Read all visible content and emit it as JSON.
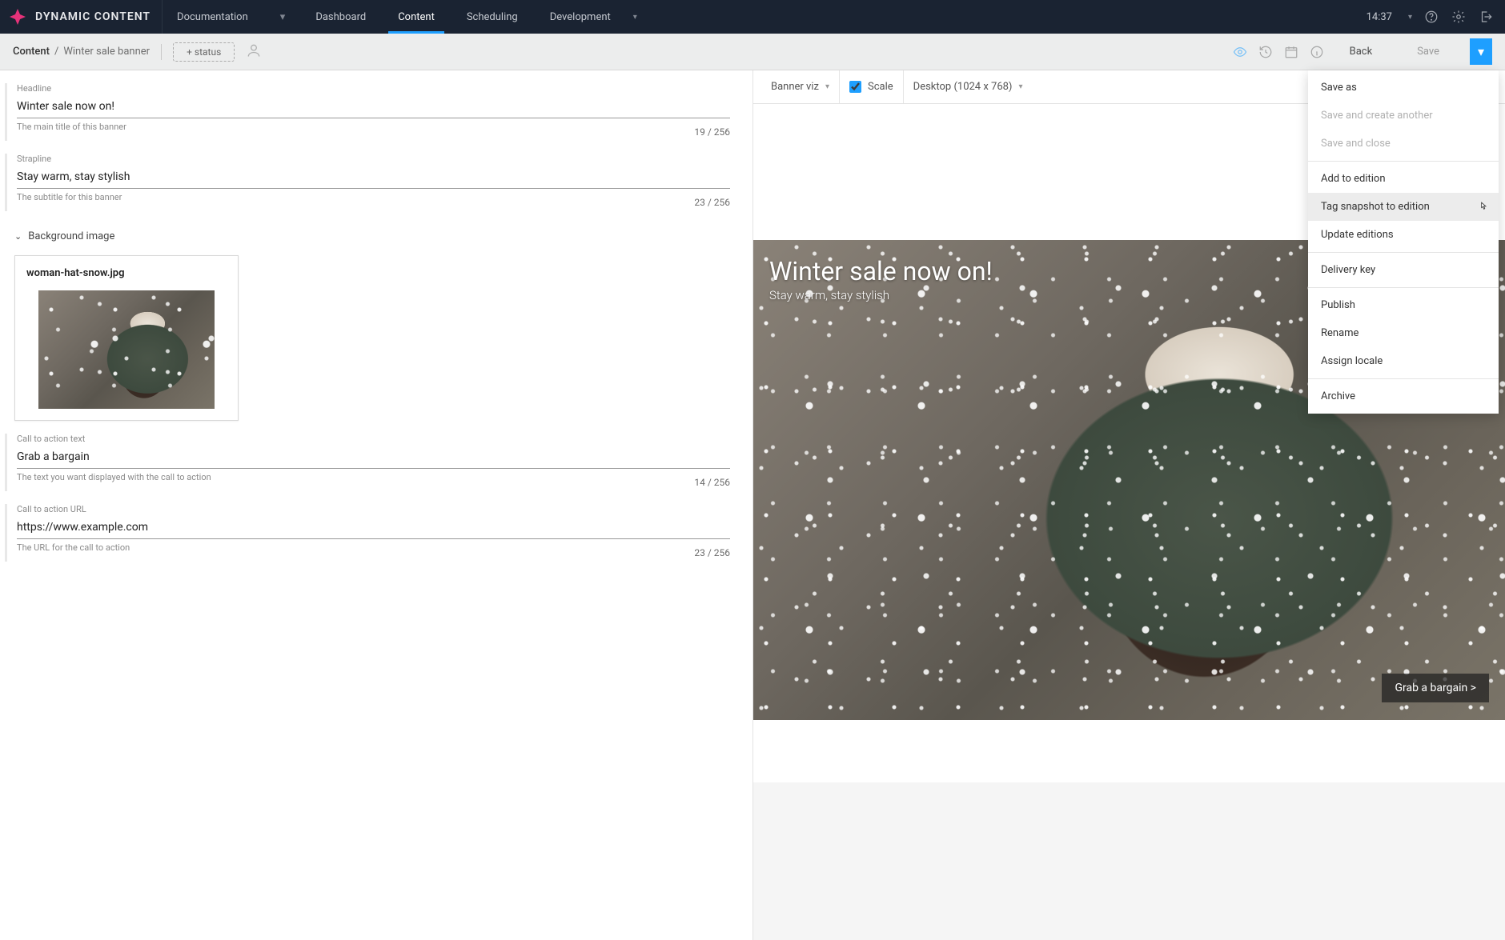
{
  "brand": "DYNAMIC CONTENT",
  "top_nav": {
    "dropdown_label": "Documentation",
    "items": [
      "Dashboard",
      "Content",
      "Scheduling",
      "Development"
    ],
    "active_index": 1,
    "time": "14:37"
  },
  "subbar": {
    "breadcrumb_root": "Content",
    "breadcrumb_leaf": "Winter sale banner",
    "status_chip": "+ status",
    "back_label": "Back",
    "save_label": "Save"
  },
  "form": {
    "headline": {
      "label": "Headline",
      "value": "Winter sale now on!",
      "hint": "The main title of this banner",
      "count": "19 / 256"
    },
    "strapline": {
      "label": "Strapline",
      "value": "Stay warm, stay stylish",
      "hint": "The subtitle for this banner",
      "count": "23 / 256"
    },
    "bg_section": {
      "title": "Background image",
      "filename": "woman-hat-snow.jpg"
    },
    "cta_text": {
      "label": "Call to action text",
      "value": "Grab a bargain",
      "hint": "The text you want displayed with the call to action",
      "count": "14 / 256"
    },
    "cta_url": {
      "label": "Call to action URL",
      "value": "https://www.example.com",
      "hint": "The URL for the call to action",
      "count": "23 / 256"
    }
  },
  "preview": {
    "viz_label": "Banner viz",
    "scale_label": "Scale",
    "device_label": "Desktop (1024 x 768)",
    "banner_title": "Winter sale now on!",
    "banner_sub": "Stay warm, stay stylish",
    "banner_cta": "Grab a bargain >"
  },
  "save_menu": {
    "save_as": "Save as",
    "save_and_another": "Save and create another",
    "save_and_close": "Save and close",
    "add_to_edition": "Add to edition",
    "tag_snapshot": "Tag snapshot to edition",
    "update_editions": "Update editions",
    "delivery_key": "Delivery key",
    "publish": "Publish",
    "rename": "Rename",
    "assign_locale": "Assign locale",
    "archive": "Archive"
  }
}
